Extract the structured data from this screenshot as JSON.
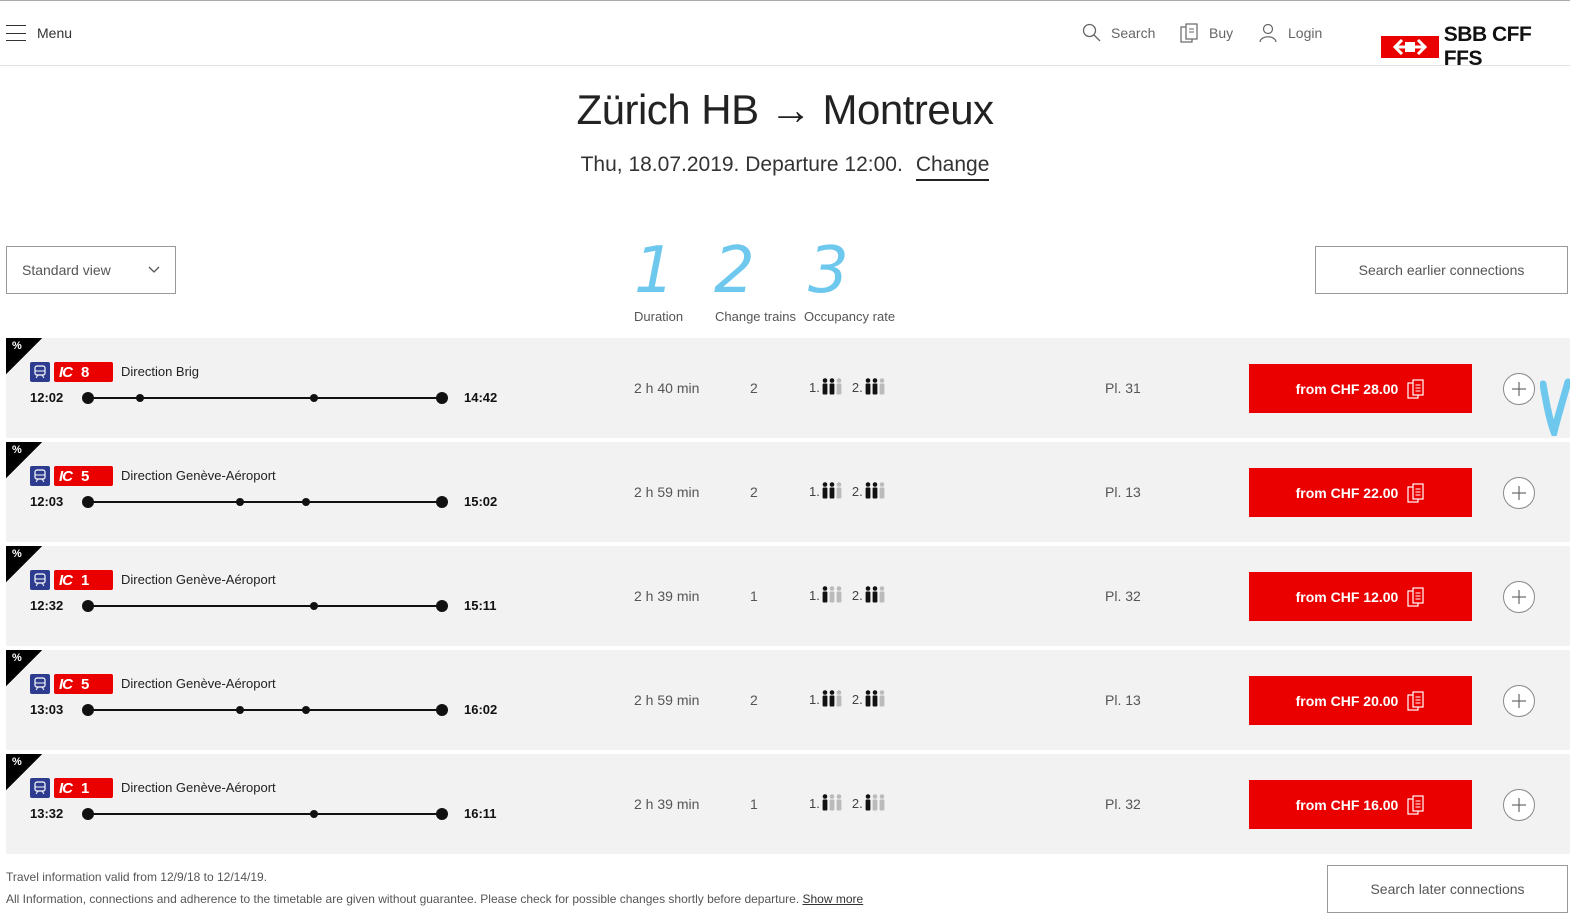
{
  "header": {
    "menu_label": "Menu",
    "search_label": "Search",
    "buy_label": "Buy",
    "login_label": "Login",
    "logo_text": "SBB CFF FFS",
    "brand_color": "#eb0000"
  },
  "journey": {
    "title": "Zürich HB → Montreux",
    "subtitle": "Thu, 18.07.2019. Departure 12:00.",
    "change_label": "Change"
  },
  "controls": {
    "view_select_value": "Standard view",
    "earlier_label": "Search earlier connections",
    "later_label": "Search later connections"
  },
  "annotations": [
    "1",
    "2",
    "3"
  ],
  "columns": {
    "duration": "Duration",
    "change_trains": "Change trains",
    "occupancy": "Occupancy rate"
  },
  "connections": [
    {
      "badge": "%",
      "train_type": "IC",
      "train_number": "8",
      "direction": "Direction Brig",
      "departure": "12:02",
      "arrival": "14:42",
      "duration": "2 h 40 min",
      "changes": "2",
      "class1": "1.",
      "class2": "2.",
      "occ1_level": 2,
      "occ2_level": 2,
      "platform": "Pl. 31",
      "price": "from CHF 28.00"
    },
    {
      "badge": "%",
      "train_type": "IC",
      "train_number": "5",
      "direction": "Direction Genève-Aéroport",
      "departure": "12:03",
      "arrival": "15:02",
      "duration": "2 h 59 min",
      "changes": "2",
      "class1": "1.",
      "class2": "2.",
      "occ1_level": 2,
      "occ2_level": 2,
      "platform": "Pl. 13",
      "price": "from CHF 22.00"
    },
    {
      "badge": "%",
      "train_type": "IC",
      "train_number": "1",
      "direction": "Direction Genève-Aéroport",
      "departure": "12:32",
      "arrival": "15:11",
      "duration": "2 h 39 min",
      "changes": "1",
      "class1": "1.",
      "class2": "2.",
      "occ1_level": 1,
      "occ2_level": 2,
      "platform": "Pl. 32",
      "price": "from CHF 12.00"
    },
    {
      "badge": "%",
      "train_type": "IC",
      "train_number": "5",
      "direction": "Direction Genève-Aéroport",
      "departure": "13:03",
      "arrival": "16:02",
      "duration": "2 h 59 min",
      "changes": "2",
      "class1": "1.",
      "class2": "2.",
      "occ1_level": 2,
      "occ2_level": 2,
      "platform": "Pl. 13",
      "price": "from CHF 20.00"
    },
    {
      "badge": "%",
      "train_type": "IC",
      "train_number": "1",
      "direction": "Direction Genève-Aéroport",
      "departure": "13:32",
      "arrival": "16:11",
      "duration": "2 h 39 min",
      "changes": "1",
      "class1": "1.",
      "class2": "2.",
      "occ1_level": 1,
      "occ2_level": 1,
      "platform": "Pl. 32",
      "price": "from CHF 16.00"
    }
  ],
  "footer": {
    "validity": "Travel information valid from 12/9/18 to 12/14/19.",
    "disclaimer": "All Information, connections and adherence to the timetable are given without guarantee. Please check for possible changes shortly before departure.",
    "show_more": "Show more"
  }
}
